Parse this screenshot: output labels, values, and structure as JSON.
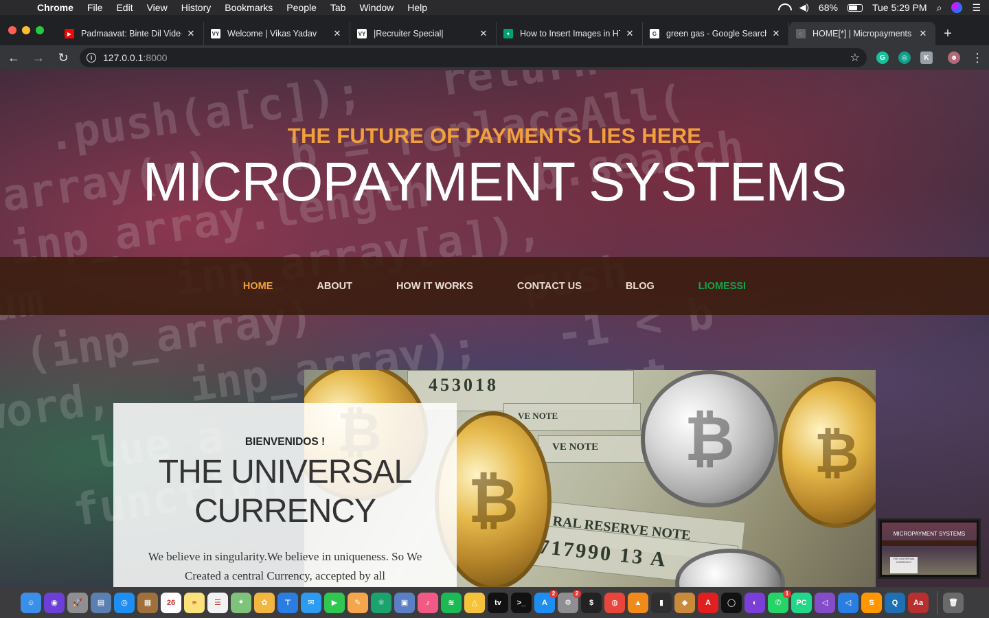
{
  "menubar": {
    "apple_icon": "apple-logo-icon",
    "items": [
      "Chrome",
      "File",
      "Edit",
      "View",
      "History",
      "Bookmarks",
      "People",
      "Tab",
      "Window",
      "Help"
    ],
    "battery_percent": "68%",
    "battery_level": 0.68,
    "clock": "Tue 5:29 PM"
  },
  "tabs": [
    {
      "title": "Padmaavat: Binte Dil Video",
      "favicon_color": "#ff0000",
      "favicon_text": "▶",
      "close": "✕"
    },
    {
      "title": "Welcome | Vikas Yadav",
      "favicon_color": "#ffffff",
      "favicon_text": "VY",
      "close": "✕"
    },
    {
      "title": "|Recruiter Special|",
      "favicon_color": "#ffffff",
      "favicon_text": "VY",
      "close": "✕"
    },
    {
      "title": "How to Insert Images in HTML",
      "favicon_color": "#00a36c",
      "favicon_text": "✦",
      "close": "✕"
    },
    {
      "title": "green gas - Google Search",
      "favicon_color": "#ffffff",
      "favicon_text": "G",
      "close": "✕"
    },
    {
      "title": "HOME[*] | Micropayments",
      "favicon_color": "#5f6368",
      "favicon_text": "◌",
      "close": "✕",
      "active": true
    }
  ],
  "toolbar": {
    "back": "←",
    "forward": "→",
    "reload": "↻",
    "url_host": "127.0.0.1",
    "url_port": ":8000",
    "star": "☆",
    "menu": "⋮"
  },
  "page": {
    "tagline": "THE FUTURE OF PAYMENTS LIES HERE",
    "title": "MICROPAYMENT SYSTEMS",
    "nav": [
      {
        "label": "HOME",
        "active": true
      },
      {
        "label": "ABOUT"
      },
      {
        "label": "HOW IT WORKS"
      },
      {
        "label": "CONTACT US"
      },
      {
        "label": "BLOG"
      },
      {
        "label": "LIOMESSI",
        "accent": true
      }
    ],
    "card": {
      "welcome": "BIENVENIDOS !",
      "heading": "THE UNIVERSAL CURRENCY",
      "text": "We believe in singularity.We believe in uniqueness. So We Created a central Currency, accepted by all"
    },
    "photo_text": {
      "serial": "453018",
      "note1": "VE NOTE",
      "note2": "VE NOTE",
      "reserve": "RAL RESERVE NOTE",
      "number": "717990 13 A"
    },
    "thumbnail": {
      "title": "MICROPAYMENT SYSTEMS",
      "card": "THE UNIVERSAL CURRENCY"
    }
  },
  "colors": {
    "accent_orange": "#f2a03d",
    "nav_bg": "#3a1c0e",
    "nav_green": "#16a34a"
  },
  "dock": [
    {
      "name": "finder-icon",
      "color": "#3b8fe8",
      "glyph": "☺"
    },
    {
      "name": "siri-icon",
      "color": "#6b3fd8",
      "glyph": "◉"
    },
    {
      "name": "launchpad-icon",
      "color": "#8e8e93",
      "glyph": "🚀"
    },
    {
      "name": "preview-icon",
      "color": "#5a7fb0",
      "glyph": "▤"
    },
    {
      "name": "safari-icon",
      "color": "#1f8ef1",
      "glyph": "◎"
    },
    {
      "name": "notefile-icon",
      "color": "#a0703c",
      "glyph": "▦"
    },
    {
      "name": "calendar-icon",
      "color": "#ffffff",
      "glyph": "26"
    },
    {
      "name": "notes-icon",
      "color": "#fbe27a",
      "glyph": "≡"
    },
    {
      "name": "reminders-icon",
      "color": "#f2f2f2",
      "glyph": "☰"
    },
    {
      "name": "maps-icon",
      "color": "#7ec27b",
      "glyph": "⌖"
    },
    {
      "name": "photos-icon",
      "color": "#f3b641",
      "glyph": "✿"
    },
    {
      "name": "keynote-icon",
      "color": "#2b7de1",
      "glyph": "⊤"
    },
    {
      "name": "messages-icon",
      "color": "#2b9cf2",
      "glyph": "✉"
    },
    {
      "name": "facetime-icon",
      "color": "#30c750",
      "glyph": "▶"
    },
    {
      "name": "pages-icon",
      "color": "#f3a64d",
      "glyph": "✎"
    },
    {
      "name": "atom-icon",
      "color": "#1aa36c",
      "glyph": "⚛"
    },
    {
      "name": "virtualbox-icon",
      "color": "#5b7fc4",
      "glyph": "▣"
    },
    {
      "name": "music-icon",
      "color": "#f25a86",
      "glyph": "♪"
    },
    {
      "name": "spotify-icon",
      "color": "#1db954",
      "glyph": "≋"
    },
    {
      "name": "drive-icon",
      "color": "#f5c33b",
      "glyph": "△"
    },
    {
      "name": "appletv-icon",
      "color": "#111111",
      "glyph": "tv"
    },
    {
      "name": "terminal-icon",
      "color": "#111111",
      "glyph": ">_"
    },
    {
      "name": "appstore-icon",
      "color": "#1f8ef1",
      "glyph": "A",
      "badge": "2"
    },
    {
      "name": "system-preferences-icon",
      "color": "#8e8e93",
      "glyph": "⚙",
      "badge": "2"
    },
    {
      "name": "iterm-icon",
      "color": "#222222",
      "glyph": "$"
    },
    {
      "name": "chrome-icon",
      "color": "#e8453c",
      "glyph": "◍"
    },
    {
      "name": "vlc-icon",
      "color": "#f08a1a",
      "glyph": "▲"
    },
    {
      "name": "activity-monitor-icon",
      "color": "#2f2f2f",
      "glyph": "▮"
    },
    {
      "name": "automator-icon",
      "color": "#c98a3b",
      "glyph": "◆"
    },
    {
      "name": "acrobat-icon",
      "color": "#e02020",
      "glyph": "A"
    },
    {
      "name": "ring-icon",
      "color": "#111111",
      "glyph": "◯"
    },
    {
      "name": "github-icon",
      "color": "#7a3fd8",
      "glyph": "◐"
    },
    {
      "name": "whatsapp-icon",
      "color": "#25d366",
      "glyph": "✆",
      "badge": "1"
    },
    {
      "name": "pycharm-icon",
      "color": "#21d789",
      "glyph": "PC"
    },
    {
      "name": "visual-studio-icon",
      "color": "#854cc7",
      "glyph": "◁"
    },
    {
      "name": "vscode-icon",
      "color": "#2a7de1",
      "glyph": "◁"
    },
    {
      "name": "sublime-icon",
      "color": "#ff9800",
      "glyph": "S"
    },
    {
      "name": "quicktime-icon",
      "color": "#1f6fb5",
      "glyph": "Q"
    },
    {
      "name": "dictionary-icon",
      "color": "#b7302f",
      "glyph": "Aa"
    },
    {
      "name": "trash-icon",
      "color": "#6a6a6a",
      "glyph": "🗑"
    }
  ]
}
